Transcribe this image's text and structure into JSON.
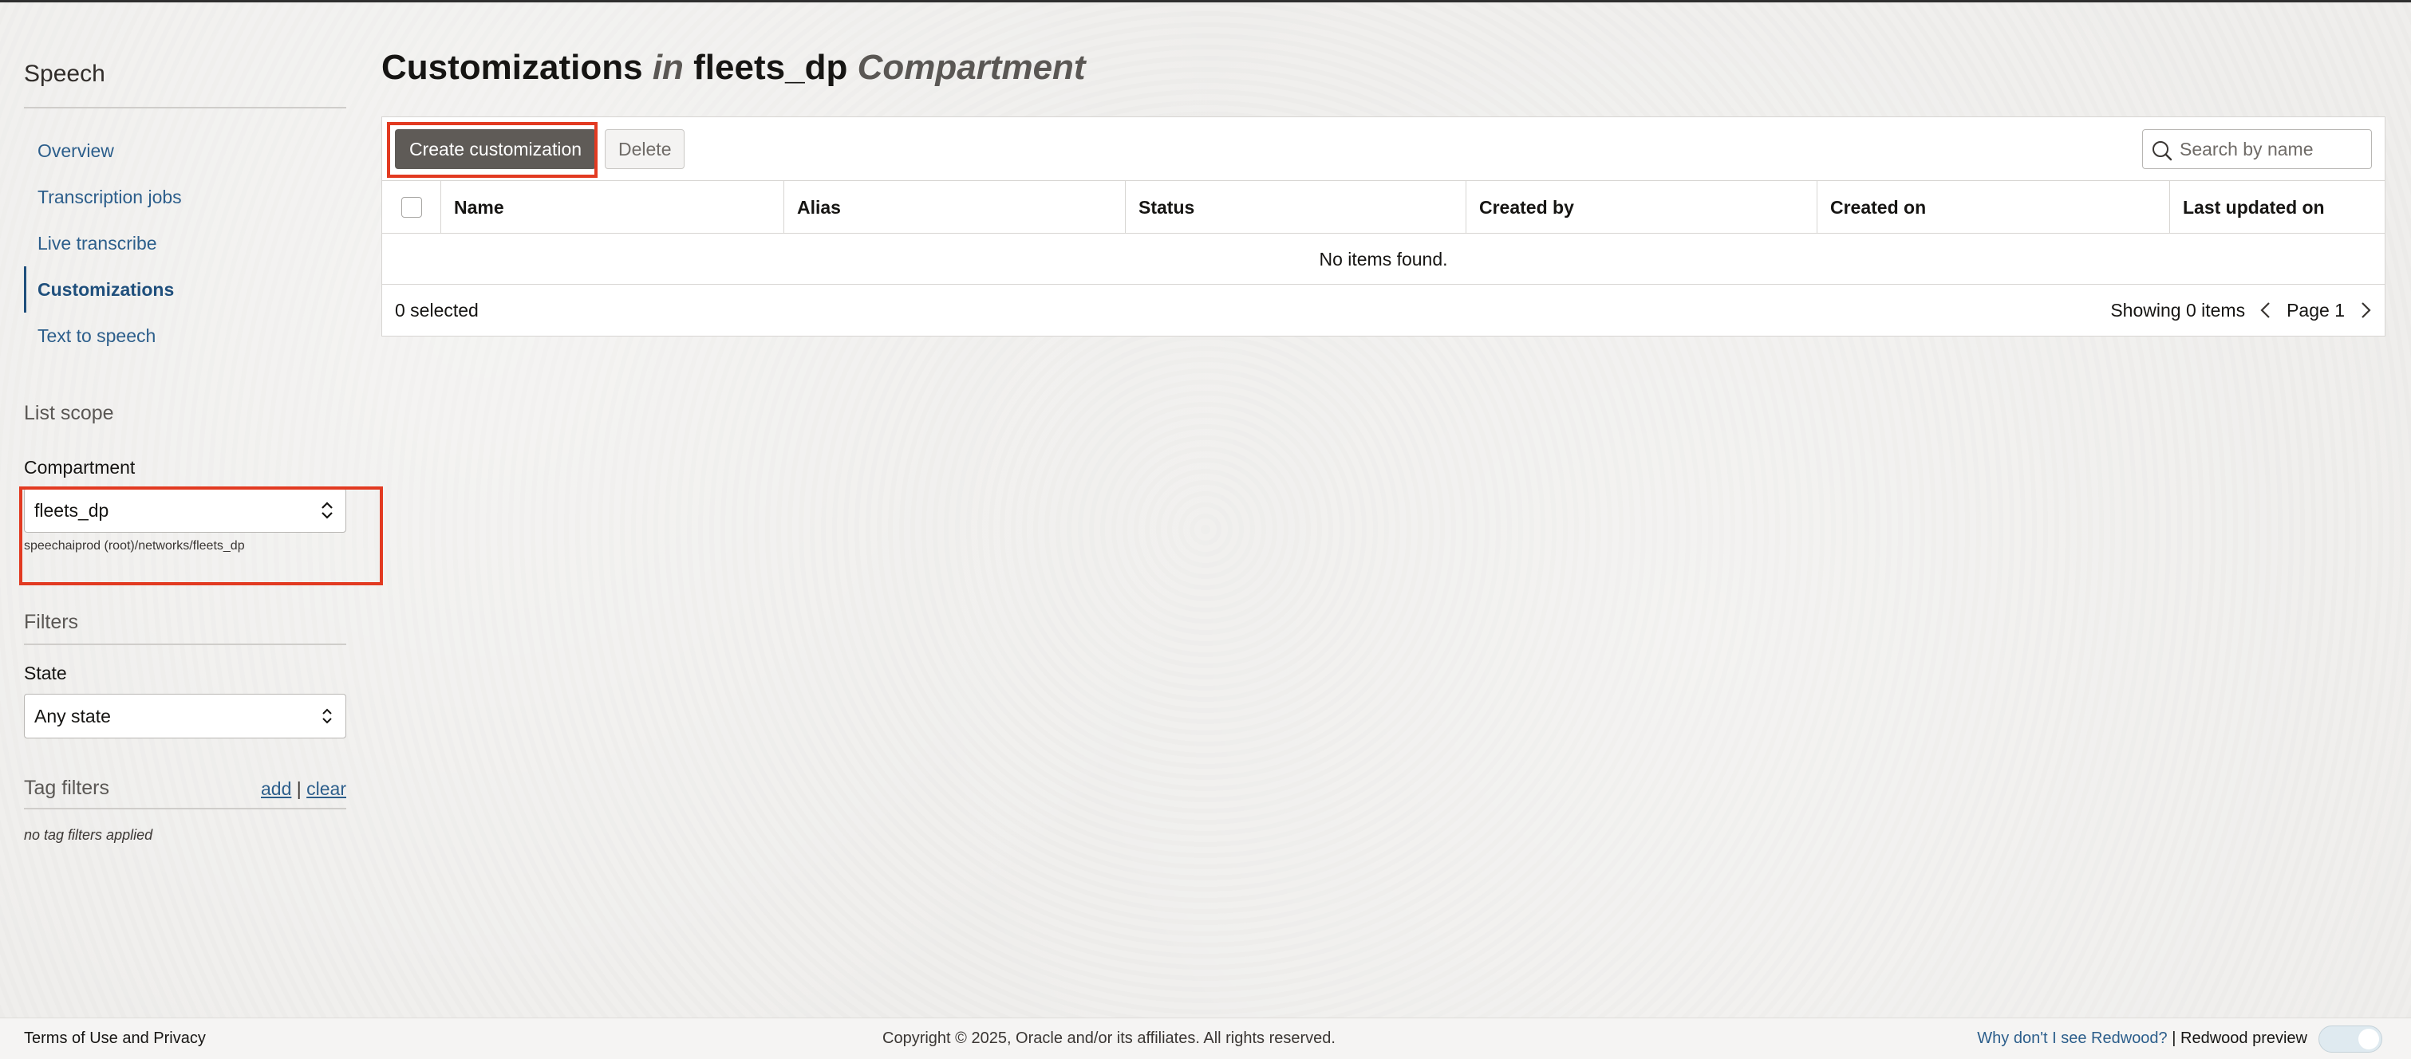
{
  "sidebar": {
    "title": "Speech",
    "nav": [
      {
        "label": "Overview"
      },
      {
        "label": "Transcription jobs"
      },
      {
        "label": "Live transcribe"
      },
      {
        "label": "Customizations"
      },
      {
        "label": "Text to speech"
      }
    ],
    "active_nav": "Customizations",
    "list_scope": {
      "title": "List scope",
      "compartment_label": "Compartment",
      "compartment_value": "fleets_dp",
      "compartment_path": "speechaiprod (root)/networks/fleets_dp"
    },
    "filters": {
      "title": "Filters",
      "state_label": "State",
      "state_value": "Any state"
    },
    "tag_filters": {
      "title": "Tag filters",
      "add_label": "add",
      "separator": "|",
      "clear_label": "clear",
      "empty_text": "no tag filters applied"
    }
  },
  "header": {
    "title_main": "Customizations",
    "title_in": "in",
    "title_compartment": "fleets_dp",
    "title_suffix": "Compartment"
  },
  "toolbar": {
    "create_label": "Create customization",
    "delete_label": "Delete",
    "search_placeholder": "Search by name"
  },
  "table": {
    "columns": [
      "Name",
      "Alias",
      "Status",
      "Created by",
      "Created on",
      "Last updated on"
    ],
    "empty_text": "No items found.",
    "selected_text": "0 selected",
    "showing_text": "Showing 0 items",
    "page_text": "Page 1"
  },
  "footer": {
    "terms": "Terms of Use and Privacy",
    "copyright": "Copyright © 2025, Oracle and/or its affiliates. All rights reserved.",
    "redwood_question": "Why don't I see Redwood?",
    "separator": "|",
    "redwood_preview": "Redwood preview"
  },
  "colors": {
    "accent": "#2c5e8b",
    "highlight": "#e23a21",
    "primary_button": "#5f5b57"
  }
}
